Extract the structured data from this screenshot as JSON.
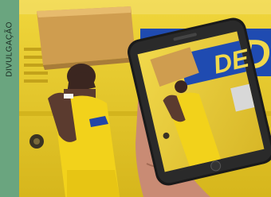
{
  "credit": {
    "label": "DIVULGAÇÃO"
  },
  "truck_lettering": "DE",
  "phone_screen_lettering": "DE",
  "colors": {
    "strip": "#6aa57f",
    "truck_yellow": "#e9cf2f",
    "truck_blue": "#1f4bb1",
    "shirt": "#f2d21b",
    "box": "#cf9d4f",
    "phone": "#1a1a1a",
    "skin": "#c98b74"
  }
}
